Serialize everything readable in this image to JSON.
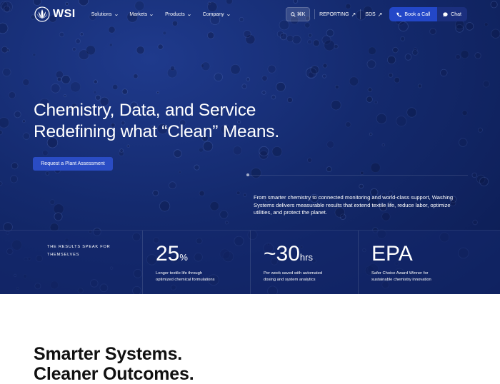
{
  "brand": {
    "name": "WSI"
  },
  "nav": {
    "menu": [
      {
        "label": "Solutions"
      },
      {
        "label": "Markets"
      },
      {
        "label": "Products"
      },
      {
        "label": "Company"
      }
    ],
    "search_shortcut": "⌘K",
    "links": [
      {
        "label": "REPORTING"
      },
      {
        "label": "SDS"
      }
    ],
    "book_call": "Book a Call",
    "chat": "Chat"
  },
  "hero": {
    "headline_line1": "Chemistry, Data, and Service",
    "headline_line2": "Redefining what “Clean” Means.",
    "cta": "Request a Plant Assessment",
    "intro": "From smarter chemistry to connected monitoring and world-class support, Washing Systems delivers measurable results that extend textile life, reduce labor, optimize utilities, and protect the planet."
  },
  "stats": {
    "label_line1": "THE RESULTS SPEAK FOR",
    "label_line2": "THEMSELVES",
    "items": [
      {
        "value": "25",
        "unit": "%",
        "desc_line1": "Longer textile life through",
        "desc_line2": "optimized chemical formulations"
      },
      {
        "value": "~30",
        "unit": "hrs",
        "desc_line1": "Per week saved with automated",
        "desc_line2": "dosing and system analytics"
      },
      {
        "value": "EPA",
        "unit": "",
        "desc_line1": "Safer Choice Award Winner for",
        "desc_line2": "sustainable chemistry innovation"
      }
    ]
  },
  "section": {
    "title_line1": "Smarter Systems.",
    "title_line2": "Cleaner Outcomes."
  },
  "colors": {
    "hero_bg": "#142a6e",
    "accent": "#2a4cc4",
    "text_on_dark": "#ffffff",
    "text_dark": "#111111"
  }
}
